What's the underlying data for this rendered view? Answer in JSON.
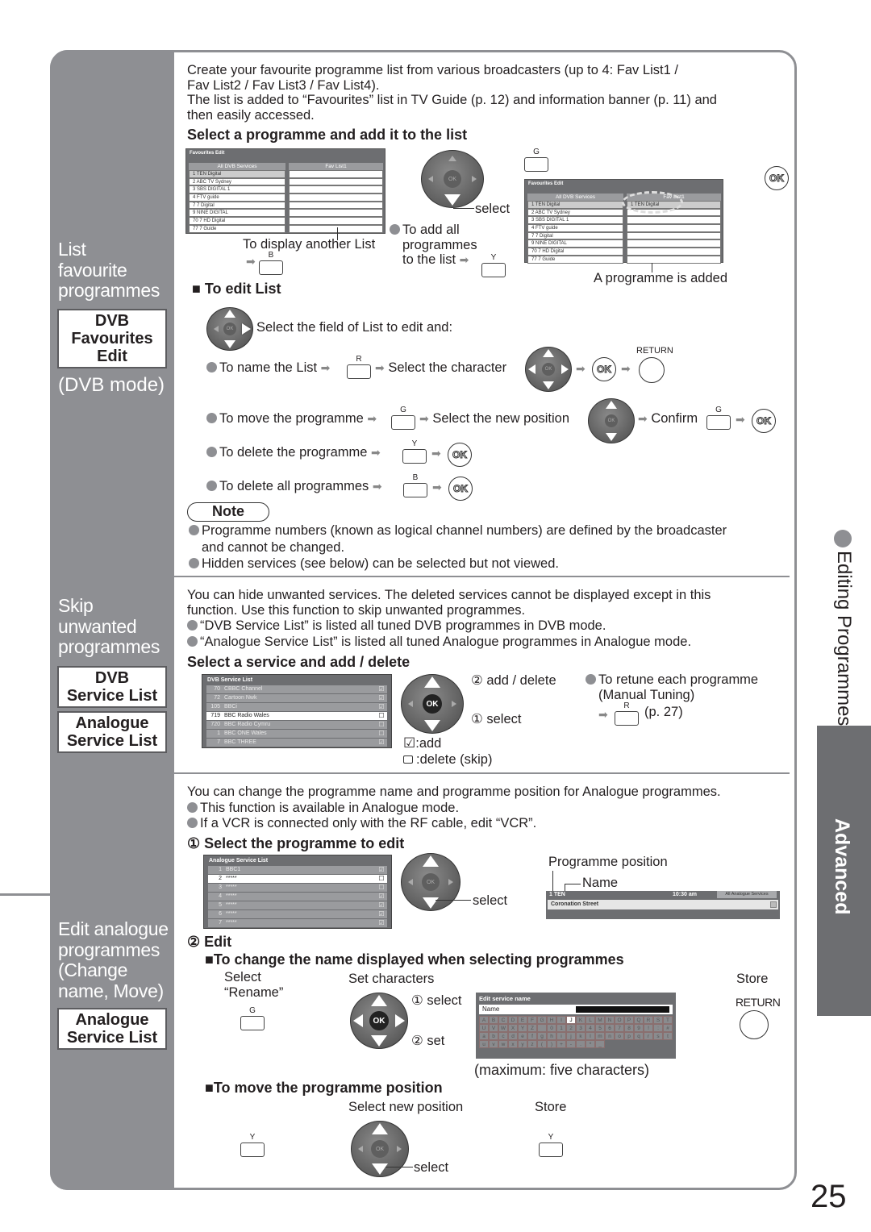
{
  "page_number": "25",
  "side_tab": {
    "chapter": "Editing Programmes",
    "section": "Advanced"
  },
  "sections": {
    "favourites": {
      "title_lines": [
        "List",
        "favourite",
        "programmes"
      ],
      "menu_box_lines": [
        "DVB",
        "Favourites",
        "Edit"
      ],
      "mode": "(DVB mode)",
      "intro": [
        "Create your favourite programme list from various broadcasters (up to 4: Fav List1 /",
        "Fav List2 / Fav List3 / Fav List4).",
        "The list is added to “Favourites” list in TV Guide (p. 12) and information banner (p. 11) and",
        "then easily accessed."
      ],
      "heading_add": "Select a programme and add it to the list",
      "screen_before": {
        "title": "Favourites Edit",
        "left_header": "All DVB Services",
        "right_header": "Fav List1",
        "services": [
          "1  TEN Digital",
          "2  ABC TV Sydney",
          "3  SBS DIGITAL 1",
          "4  FTV guide",
          "7  7 Digital",
          "9  NINE DIGITAL",
          "70  7 HD Digital",
          "77  7 Guide"
        ],
        "fav_items": []
      },
      "screen_after": {
        "title": "Favourites Edit",
        "left_header": "All DVB Services",
        "right_header": "Fav List1",
        "services": [
          "1  TEN Digital",
          "2  ABC TV Sydney",
          "3  SBS DIGITAL 1",
          "4  FTV guide",
          "7  7 Digital",
          "9  NINE DIGITAL",
          "70  7 HD Digital",
          "77  7 Guide"
        ],
        "fav_items": [
          "1  TEN Digital"
        ]
      },
      "display_another": "To display another List",
      "select_label": "select",
      "add_all_lines": [
        "To add all",
        "programmes",
        "to the list"
      ],
      "programme_added": "A programme is added",
      "edit_heading": "To edit List",
      "edit_select_field": "Select the field of List to edit and:",
      "name_list": "To name the List",
      "select_character": "Select the character",
      "return_label": "RETURN",
      "move_programme": "To move the programme",
      "select_new_position": "Select the new position",
      "confirm": "Confirm",
      "delete_programme": "To delete the programme",
      "delete_all": "To delete all programmes",
      "note_label": "Note",
      "notes": [
        "Programme numbers (known as logical channel numbers) are defined by the broadcaster",
        "and cannot be changed.",
        "Hidden services (see below) can be selected but not viewed."
      ]
    },
    "skip": {
      "title_lines": [
        "Skip",
        "unwanted",
        "programmes"
      ],
      "menu_box1_lines": [
        "DVB",
        "Service List"
      ],
      "menu_box2_lines": [
        "Analogue",
        "Service List"
      ],
      "intro": [
        "You can hide unwanted services. The deleted services cannot be displayed except in this",
        "function. Use this function to skip unwanted programmes.",
        "“DVB Service List” is listed all tuned DVB programmes in DVB mode.",
        "“Analogue Service List” is listed all tuned Analogue programmes in Analogue mode."
      ],
      "heading": "Select a service and add / delete",
      "screen": {
        "title": "DVB Service List",
        "rows": [
          {
            "num": "70",
            "name": "CBBC Channel",
            "checked": true
          },
          {
            "num": "72",
            "name": "Cartoon Nwk",
            "checked": true
          },
          {
            "num": "105",
            "name": "BBCi",
            "checked": true
          },
          {
            "num": "719",
            "name": "BBC Radio Wales",
            "checked": false,
            "highlight": true
          },
          {
            "num": "720",
            "name": "BBC Radio Cymru",
            "checked": false
          },
          {
            "num": "1",
            "name": "BBC ONE Wales",
            "checked": false
          },
          {
            "num": "7",
            "name": "BBC THREE",
            "checked": true
          }
        ]
      },
      "add_delete": "② add / delete",
      "select": "① select",
      "legend_add": ":add",
      "legend_delete": ":delete (skip)",
      "retune_lines": [
        "To retune each programme",
        "(Manual Tuning)"
      ],
      "retune_page": "(p. 27)"
    },
    "analogue": {
      "title_lines": [
        "Edit analogue",
        "programmes",
        "(Change",
        "name, Move)"
      ],
      "menu_box_lines": [
        "Analogue",
        "Service List"
      ],
      "intro": [
        "You can change the programme name and programme position for Analogue programmes.",
        "This function is available in Analogue mode.",
        "If a VCR is connected only with the RF cable, edit “VCR”."
      ],
      "step1": "① Select the programme to edit",
      "screen": {
        "title": "Analogue Service List",
        "rows": [
          {
            "num": "1",
            "name": "BBC1",
            "checked": true
          },
          {
            "num": "2",
            "name": "*****",
            "checked": false,
            "highlight": true
          },
          {
            "num": "3",
            "name": "*****",
            "checked": false
          },
          {
            "num": "4",
            "name": "*****",
            "checked": true
          },
          {
            "num": "5",
            "name": "*****",
            "checked": true
          },
          {
            "num": "6",
            "name": "*****",
            "checked": true
          },
          {
            "num": "7",
            "name": "*****",
            "checked": true
          }
        ]
      },
      "select": "select",
      "programme_position": "Programme position",
      "name_label": "Name",
      "banner": {
        "channel": "1 TEN",
        "time": "10:30 am",
        "tab": "All Analogue Services",
        "programme": "Coronation Street"
      },
      "step2": "② Edit",
      "change_name_heading": "To change the name displayed when selecting programmes",
      "select_rename_lines": [
        "Select",
        "“Rename”"
      ],
      "set_characters": "Set characters",
      "store": "Store",
      "select1": "① select",
      "set2": "② set",
      "return_label": "RETURN",
      "edit_screen": {
        "title": "Edit service name",
        "field_label": "Name",
        "keys": [
          "A",
          "B",
          "C",
          "D",
          "E",
          "F",
          "G",
          "H",
          "I",
          "J",
          "K",
          "L",
          "M",
          "N",
          "O",
          "P",
          "Q",
          "R",
          "S",
          "T",
          "U",
          "V",
          "W",
          "X",
          "Y",
          "Z",
          " ",
          "0",
          "1",
          "2",
          "3",
          "4",
          "5",
          "6",
          "7",
          "8",
          "9",
          "!",
          ":",
          "#",
          "a",
          "b",
          "c",
          "d",
          "e",
          "f",
          "g",
          "h",
          "i",
          "j",
          "k",
          "l",
          "m",
          "n",
          "o",
          "p",
          "q",
          "r",
          "s",
          "t",
          "u",
          "v",
          "w",
          "x",
          "y",
          "z",
          "(",
          ")",
          "+",
          "-",
          ".",
          "*",
          "_"
        ],
        "selected_key": "J"
      },
      "max_chars": "(maximum: five characters)",
      "move_heading": "To move the programme position",
      "select_new_position": "Select new position",
      "store2": "Store",
      "select_move": "select"
    }
  },
  "buttons": {
    "G": "G",
    "B": "B",
    "Y": "Y",
    "R": "R",
    "OK": "OK"
  }
}
